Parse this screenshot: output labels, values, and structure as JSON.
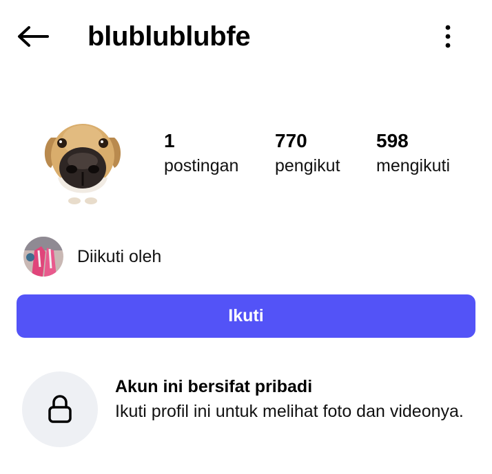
{
  "header": {
    "username": "blublublubfe",
    "back_icon": "arrow-left-icon",
    "more_icon": "more-vertical-icon"
  },
  "profile": {
    "avatar": "dog-face-avatar",
    "stats": [
      {
        "value": "1",
        "label": "postingan"
      },
      {
        "value": "770",
        "label": "pengikut"
      },
      {
        "value": "598",
        "label": "mengikuti"
      }
    ],
    "followed_by_text": "Diikuti oleh"
  },
  "actions": {
    "follow_label": "Ikuti",
    "accent_color": "#5353f7"
  },
  "private_notice": {
    "icon": "lock-icon",
    "title": "Akun ini bersifat pribadi",
    "description": "Ikuti profil ini untuk melihat foto dan videonya."
  }
}
